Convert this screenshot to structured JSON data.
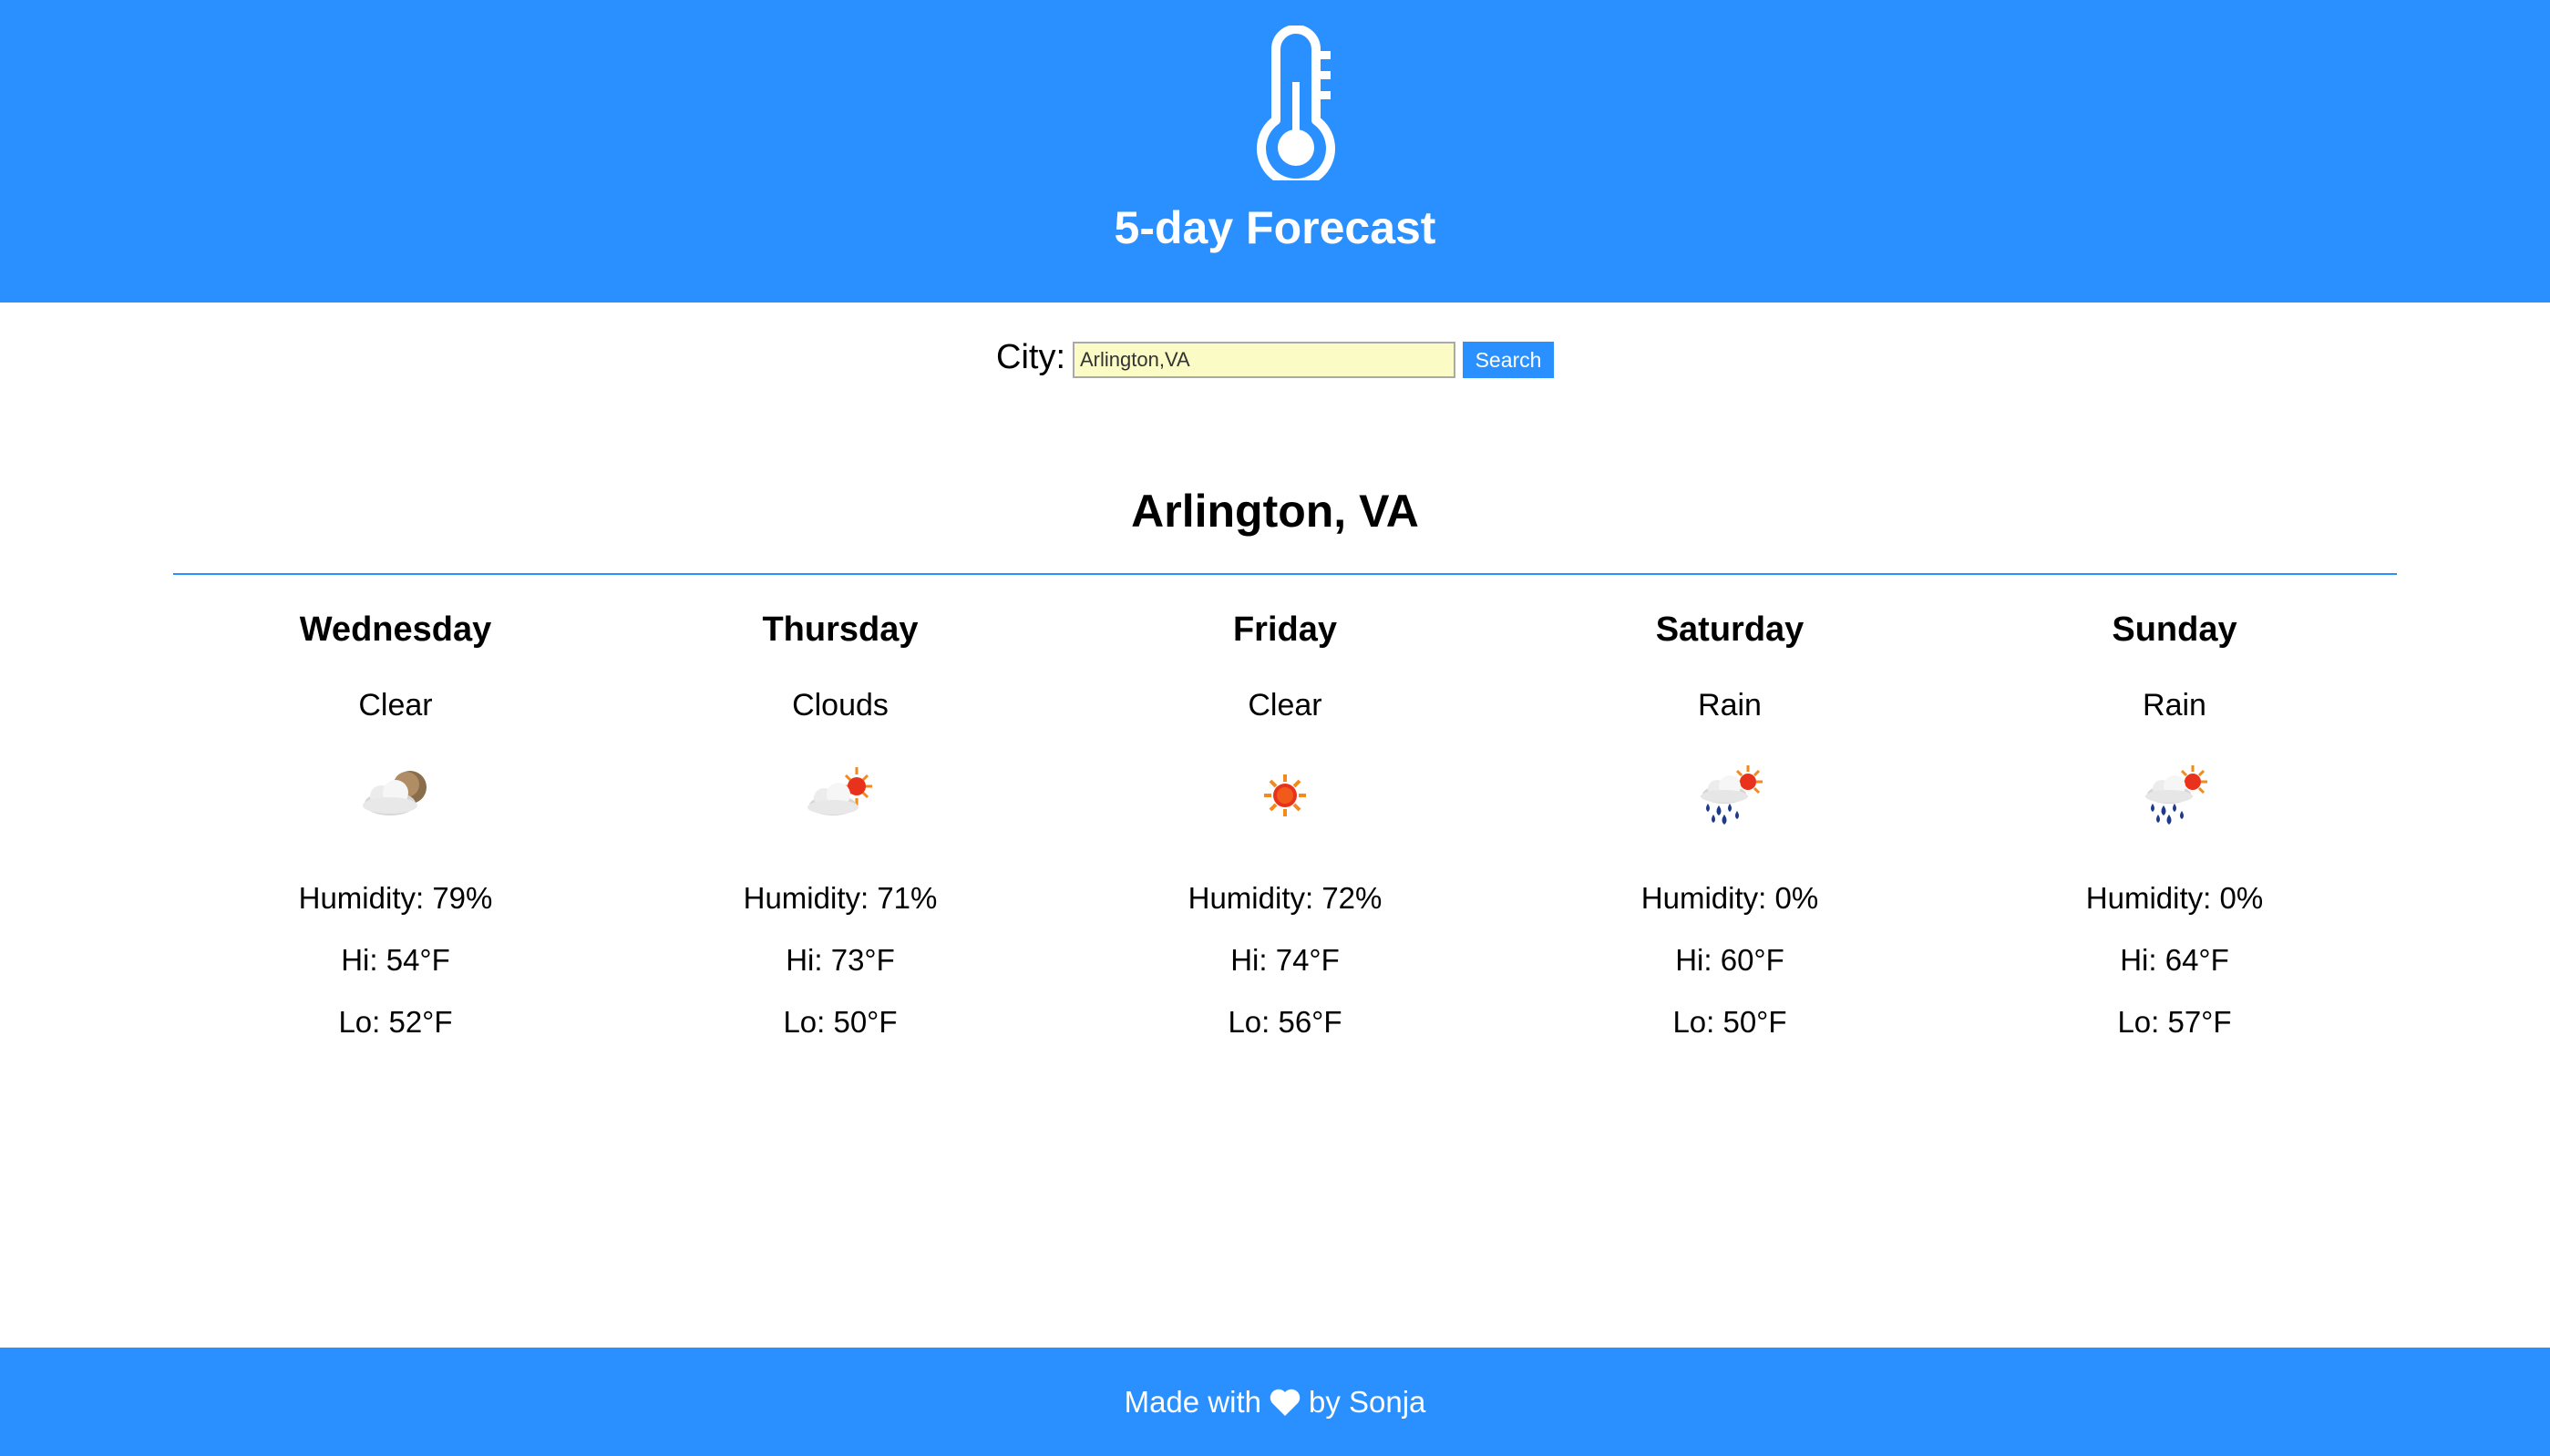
{
  "header": {
    "title": "5-day Forecast",
    "icon": "thermometer-icon",
    "background_color": "#2b90ff"
  },
  "search": {
    "label": "City:",
    "value": "Arlington,VA",
    "button_label": "Search"
  },
  "location": {
    "title": "Arlington, VA"
  },
  "forecast": [
    {
      "day": "Wednesday",
      "condition": "Clear",
      "icon": "night-cloud-moon-icon",
      "humidity": "Humidity: 79%",
      "hi": "Hi: 54°F",
      "lo": "Lo: 52°F"
    },
    {
      "day": "Thursday",
      "condition": "Clouds",
      "icon": "cloud-sun-icon",
      "humidity": "Humidity: 71%",
      "hi": "Hi: 73°F",
      "lo": "Lo: 50°F"
    },
    {
      "day": "Friday",
      "condition": "Clear",
      "icon": "sun-icon",
      "humidity": "Humidity: 72%",
      "hi": "Hi: 74°F",
      "lo": "Lo: 56°F"
    },
    {
      "day": "Saturday",
      "condition": "Rain",
      "icon": "rain-sun-icon",
      "humidity": "Humidity: 0%",
      "hi": "Hi: 60°F",
      "lo": "Lo: 50°F"
    },
    {
      "day": "Sunday",
      "condition": "Rain",
      "icon": "rain-sun-icon",
      "humidity": "Humidity: 0%",
      "hi": "Hi: 64°F",
      "lo": "Lo: 57°F"
    }
  ],
  "footer": {
    "prefix": "Made with",
    "icon": "heart-icon",
    "suffix": "by Sonja"
  }
}
